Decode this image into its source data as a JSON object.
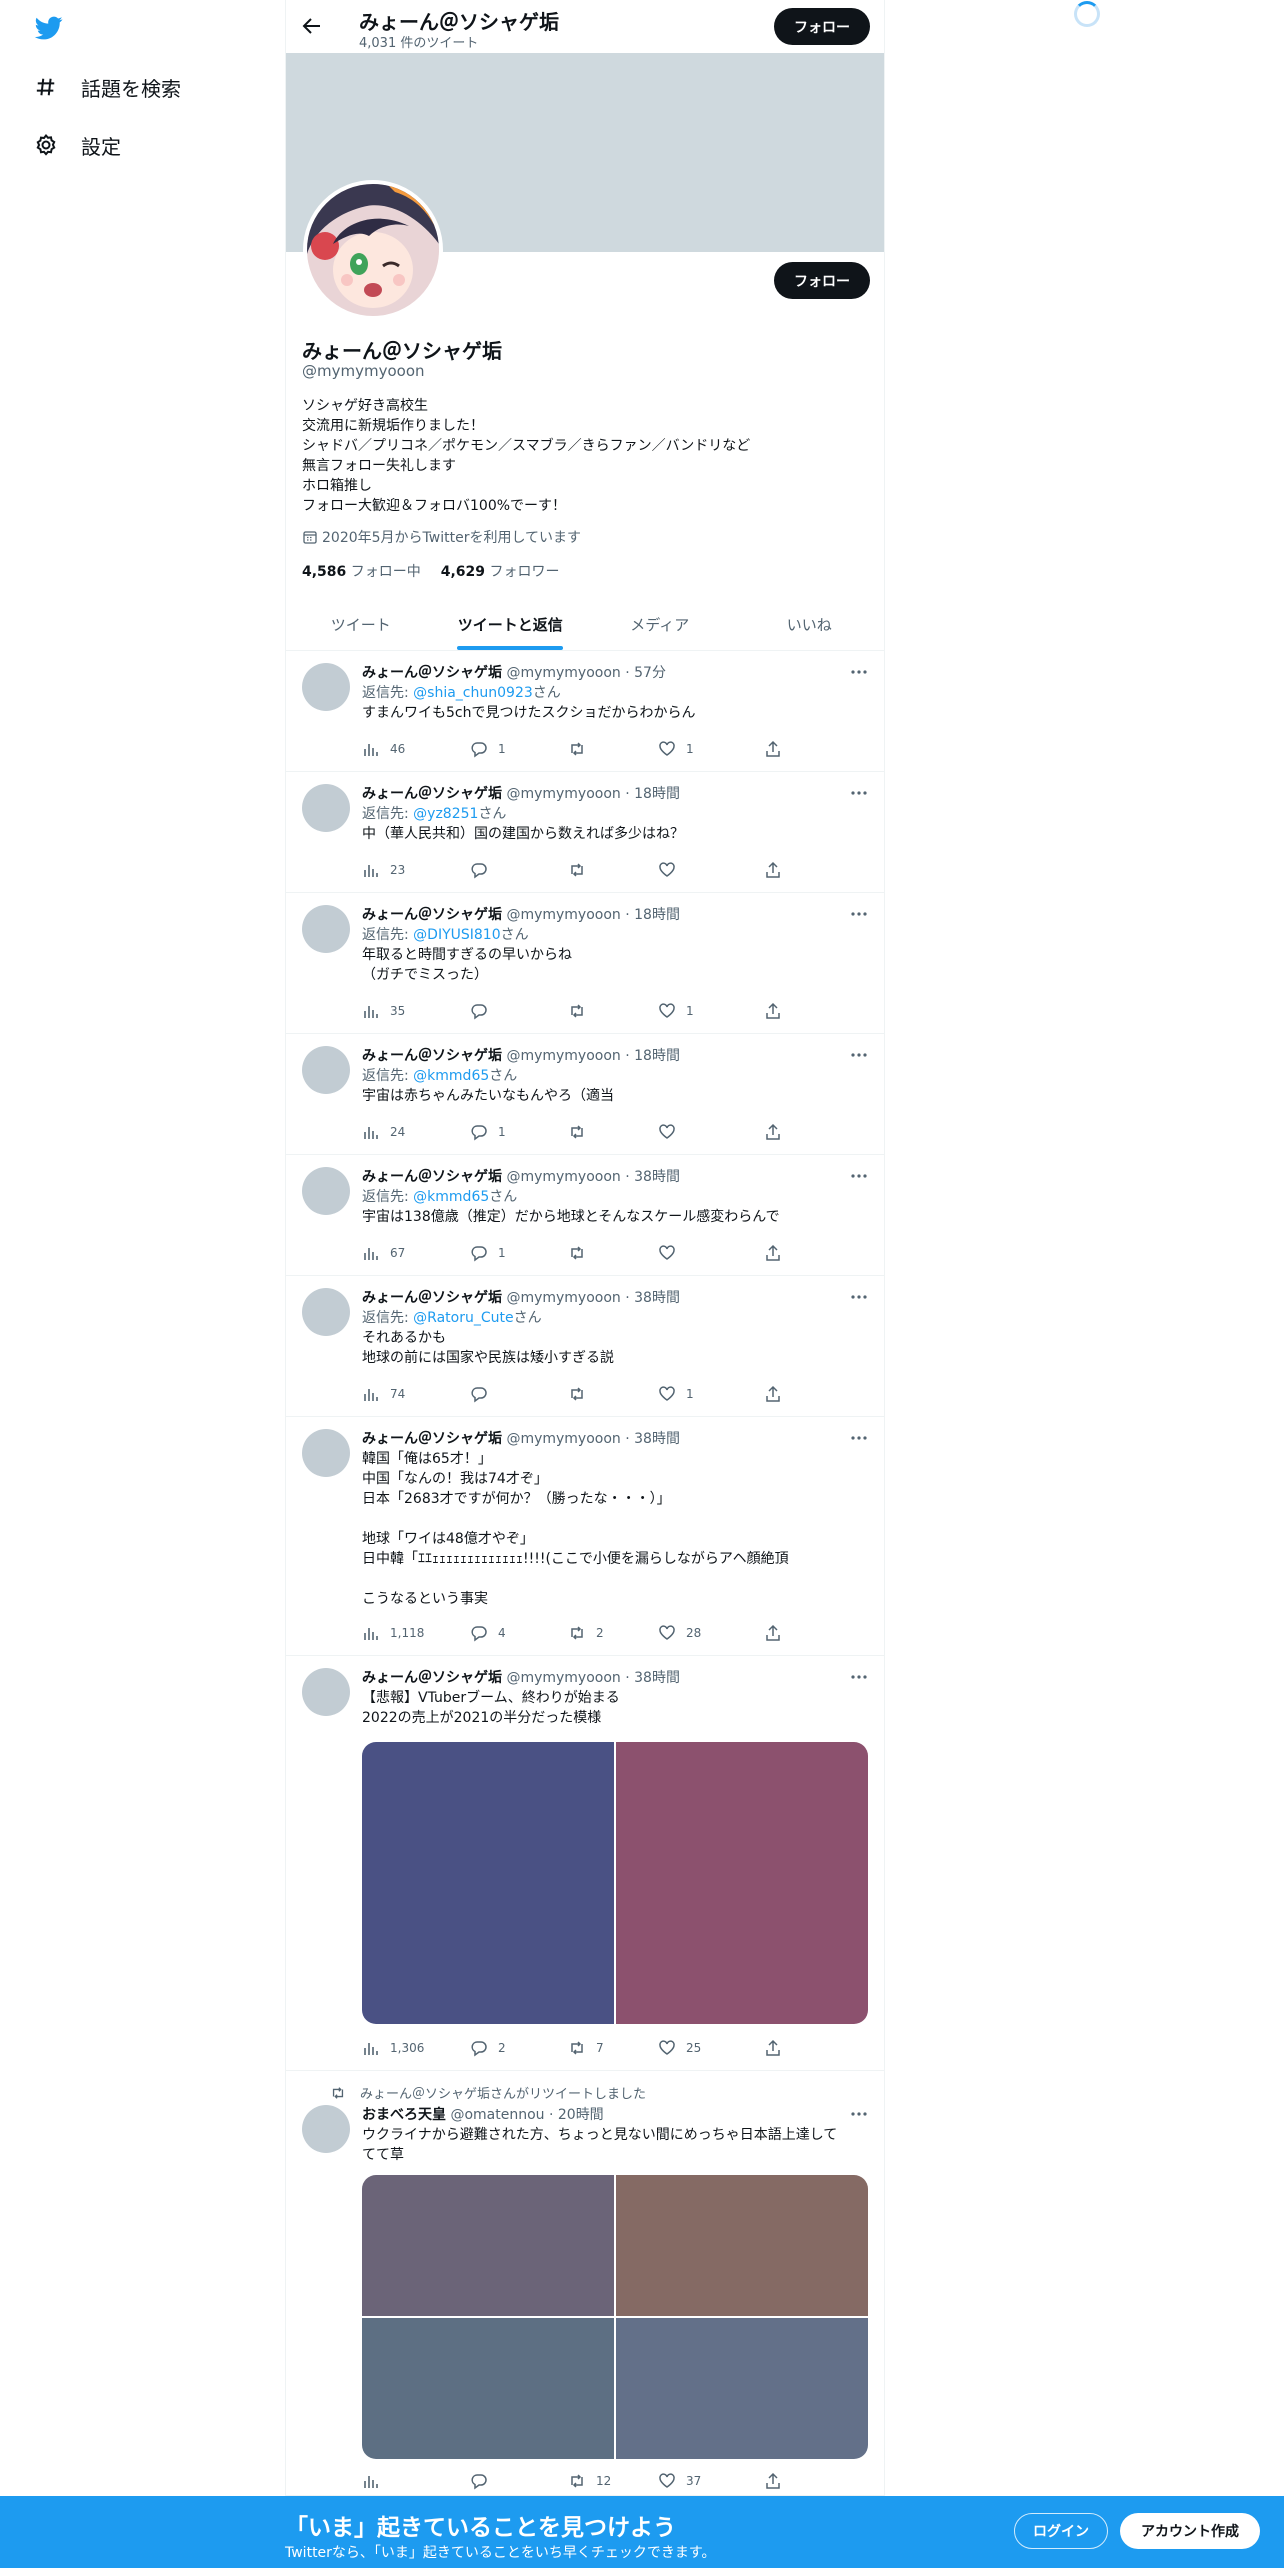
{
  "nav": {
    "explore_label": "話題を検索",
    "settings_label": "設定"
  },
  "header": {
    "name": "みょーん＠ソシャゲ垢",
    "tweet_count": "4,031 件のツイート",
    "follow_label": "フォロー"
  },
  "profile": {
    "name": "みょーん＠ソシャゲ垢",
    "handle": "@mymymyooon",
    "follow_label": "フォロー",
    "bio": [
      "ソシャゲ好き高校生",
      "交流用に新規垢作りました！",
      "シャドバ／プリコネ／ポケモン／スマブラ／きらファン／バンドリなど",
      "無言フォロー失礼します",
      "ホロ箱推し",
      "フォロー大歓迎＆フォロバ100%でーす！"
    ],
    "joined": "2020年5月からTwitterを利用しています",
    "following_count": "4,586",
    "following_label": "フォロー中",
    "followers_count": "4,629",
    "followers_label": "フォロワー"
  },
  "tabs": [
    {
      "label": "ツイート"
    },
    {
      "label": "ツイートと返信"
    },
    {
      "label": "メディア"
    },
    {
      "label": "いいね"
    }
  ],
  "tweets": [
    {
      "name": "みょーん＠ソシャゲ垢",
      "meta": "@mymymyooon · 57分",
      "reply_prefix": "返信先: ",
      "reply_to": "@shia_chun0923",
      "reply_suffix": "さん",
      "text": [
        "すまんワイも5chで見つけたスクショだからわからん"
      ],
      "views": "46",
      "replies": "1",
      "retweets": "",
      "likes": "1"
    },
    {
      "name": "みょーん＠ソシャゲ垢",
      "meta": "@mymymyooon · 18時間",
      "reply_prefix": "返信先: ",
      "reply_to": "@yz8251",
      "reply_suffix": "さん",
      "text": [
        "中（華人民共和）国の建国から数えれば多少はね？"
      ],
      "views": "23",
      "replies": "",
      "retweets": "",
      "likes": ""
    },
    {
      "name": "みょーん＠ソシャゲ垢",
      "meta": "@mymymyooon · 18時間",
      "reply_prefix": "返信先: ",
      "reply_to": "@DIYUSI810",
      "reply_suffix": "さん",
      "text": [
        "年取ると時間すぎるの早いからね",
        "（ガチでミスった）"
      ],
      "views": "35",
      "replies": "",
      "retweets": "",
      "likes": "1"
    },
    {
      "name": "みょーん＠ソシャゲ垢",
      "meta": "@mymymyooon · 18時間",
      "reply_prefix": "返信先: ",
      "reply_to": "@kmmd65",
      "reply_suffix": "さん",
      "text": [
        "宇宙は赤ちゃんみたいなもんやろ（適当"
      ],
      "views": "24",
      "replies": "1",
      "retweets": "",
      "likes": ""
    },
    {
      "name": "みょーん＠ソシャゲ垢",
      "meta": "@mymymyooon · 38時間",
      "reply_prefix": "返信先: ",
      "reply_to": "@kmmd65",
      "reply_suffix": "さん",
      "text": [
        "宇宙は138億歳（推定）だから地球とそんなスケール感変わらんで"
      ],
      "views": "67",
      "replies": "1",
      "retweets": "",
      "likes": ""
    },
    {
      "name": "みょーん＠ソシャゲ垢",
      "meta": "@mymymyooon · 38時間",
      "reply_prefix": "返信先: ",
      "reply_to": "@Ratoru_Cute",
      "reply_suffix": "さん",
      "text": [
        "それあるかも",
        "地球の前には国家や民族は矮小すぎる説"
      ],
      "views": "74",
      "replies": "",
      "retweets": "",
      "likes": "1"
    },
    {
      "name": "みょーん＠ソシャゲ垢",
      "meta": "@mymymyooon · 38時間",
      "text": [
        "韓国「俺は65才！」",
        "中国「なんの！我は74才ぞ」",
        "日本「2683才ですが何か？（勝ったな・・・）」",
        "",
        "地球「ワイは48億才やぞ」",
        "日中韓「ｴｴｪｪｪｪｪｪｪｪｪｪｪｪｪ!!!!(ここで小便を漏らしながらアヘ顔絶頂",
        "",
        "こうなるという事実"
      ],
      "views": "1,118",
      "replies": "4",
      "retweets": "2",
      "likes": "28"
    },
    {
      "name": "みょーん＠ソシャゲ垢",
      "meta": "@mymymyooon · 38時間",
      "text": [
        "【悲報】VTuberブーム、終わりが始まる",
        "2022の売上が2021の半分だった模様"
      ],
      "views": "1,306",
      "replies": "2",
      "retweets": "7",
      "likes": "25"
    },
    {
      "retweet_note": "みょーん＠ソシャゲ垢さんがリツイートしました",
      "name": "おまべろ天皇",
      "meta": "@omatennou · 20時間",
      "text": [
        "ウクライナから避難された方、ちょっと見ない間にめっちゃ日本語上達して",
        "てて草"
      ],
      "views": "",
      "replies": "",
      "retweets": "12",
      "likes": "37"
    }
  ],
  "media_colors": {
    "t8": [
      "#4a5184",
      "#8c516e"
    ],
    "t9": [
      "#6b6478",
      "#856a64",
      "#5d6f83",
      "#637089"
    ]
  },
  "bottom": {
    "title": "「いま」起きていることを見つけよう",
    "subtitle": "Twitterなら、「いま」起きていることをいち早くチェックできます。",
    "login_label": "ログイン",
    "signup_label": "アカウント作成"
  },
  "colors": {
    "accent": "#1d9bf0",
    "text": "#0f1419",
    "muted": "#536471",
    "banner": "#cfd9de"
  }
}
